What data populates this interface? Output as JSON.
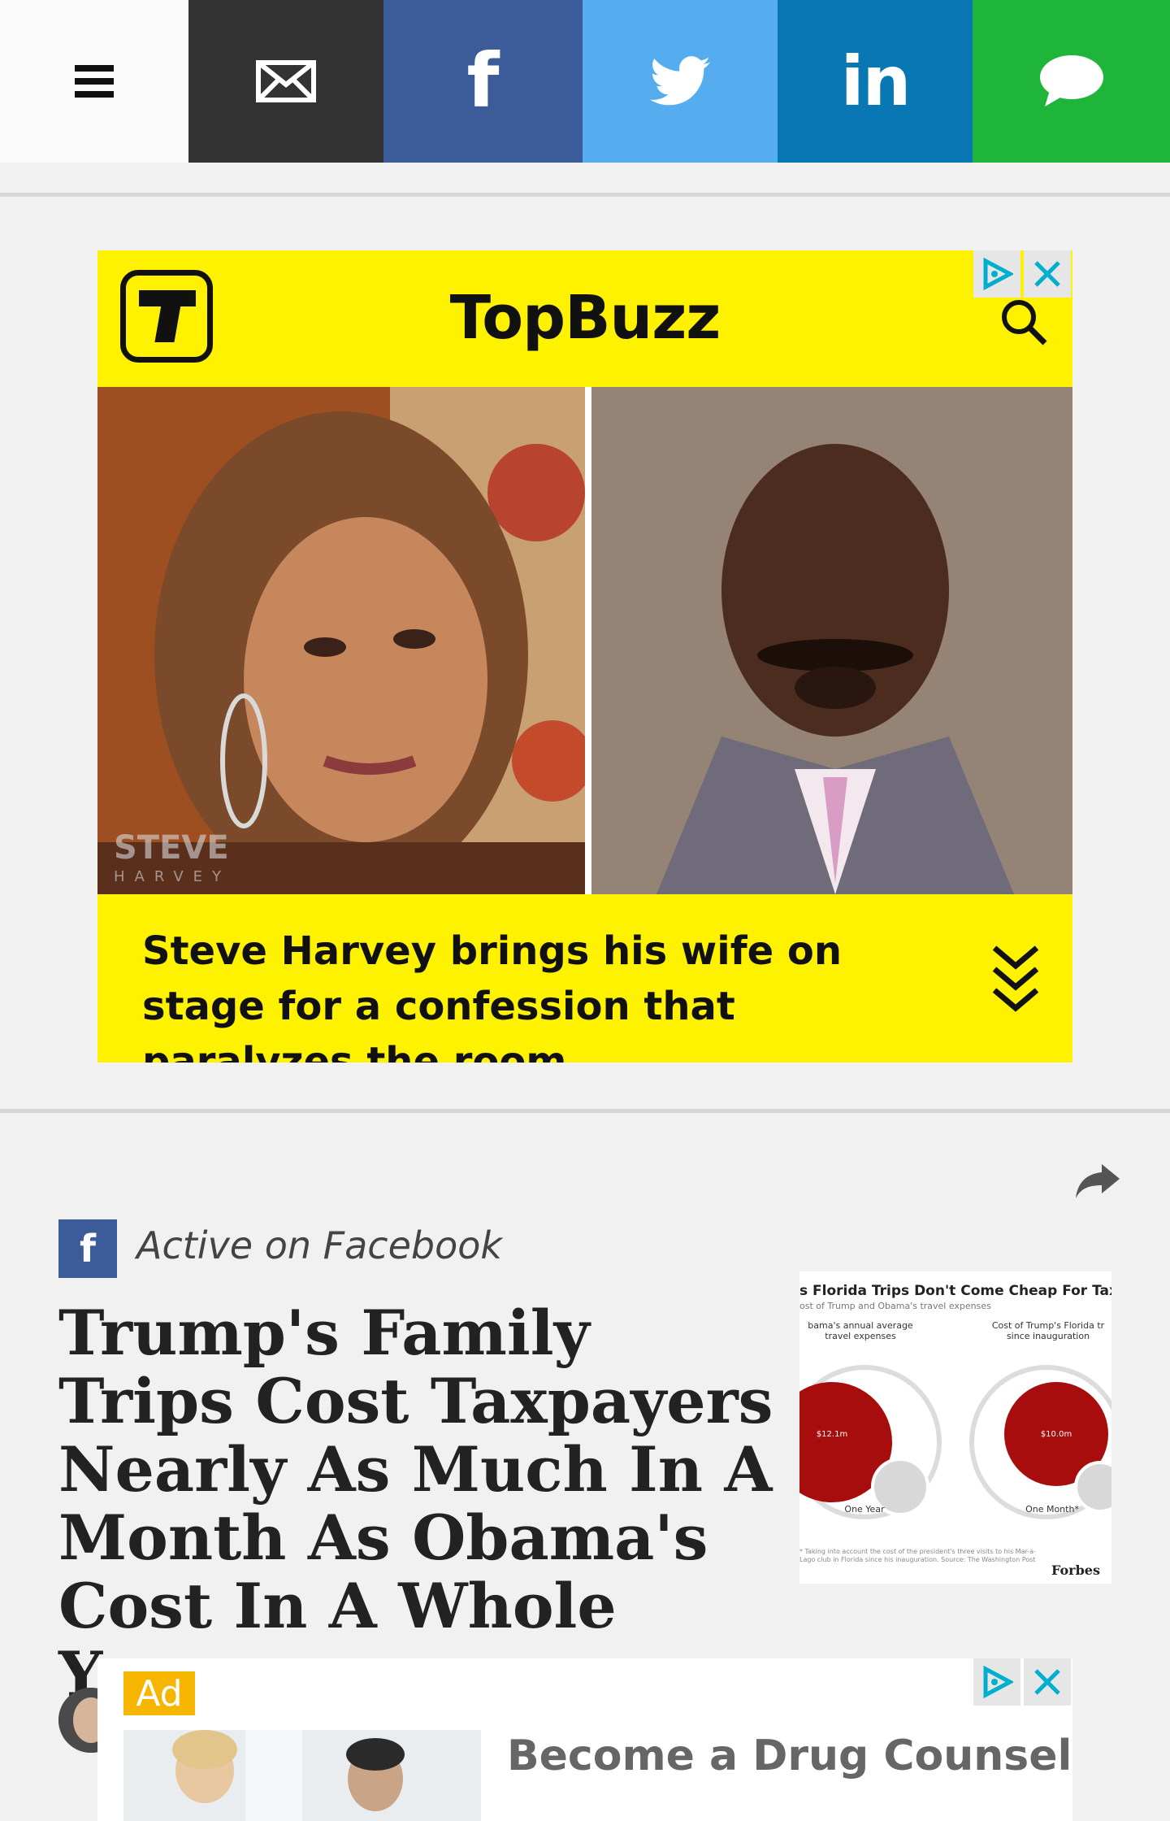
{
  "share_bar": {
    "menu_icon": "hamburger-menu-icon",
    "buttons": [
      {
        "name": "email",
        "icon": "envelope-icon",
        "color": "#333333"
      },
      {
        "name": "facebook",
        "icon": "facebook-icon",
        "color": "#3b5b99"
      },
      {
        "name": "twitter",
        "icon": "twitter-bird-icon",
        "color": "#55acee"
      },
      {
        "name": "linkedin",
        "icon": "linkedin-icon",
        "color": "#0a77b5"
      },
      {
        "name": "sms",
        "icon": "chat-bubble-icon",
        "color": "#1fb53a"
      }
    ],
    "facebook_glyph": "f",
    "linkedin_glyph": "in"
  },
  "ad_top": {
    "brand": "TopBuzz",
    "brand_color": "#fff200",
    "caption": "Steve Harvey brings his wife on stage for a confession that paralyzes the room",
    "watermark": "STEVE HARVEY"
  },
  "article": {
    "source_label": "Active on Facebook",
    "source_badge": "f",
    "headline": "Trump's Family Trips Cost Taxpayers Nearly As Much In A Month As Obama's Cost In A Whole Year",
    "thumbnail": {
      "title": "s Florida Trips Don't Come Cheap For Taxpa",
      "subtitle": "ost of Trump and Obama's travel expenses",
      "left_label": "bama's annual average travel expenses",
      "right_label": "Cost of Trump's Florida tr since inauguration",
      "left_value": "$12.1m",
      "right_value": "$10.0m",
      "left_period": "One Year",
      "right_period": "One Month*",
      "note": "* Taking into account the cost of the president's three visits to his Mar-a-Lago club in Florida since his inauguration. Source: The Washington Post",
      "brand": "Forbes"
    }
  },
  "ad_bottom": {
    "tag": "Ad",
    "text": "Become a Drug Counselor"
  }
}
